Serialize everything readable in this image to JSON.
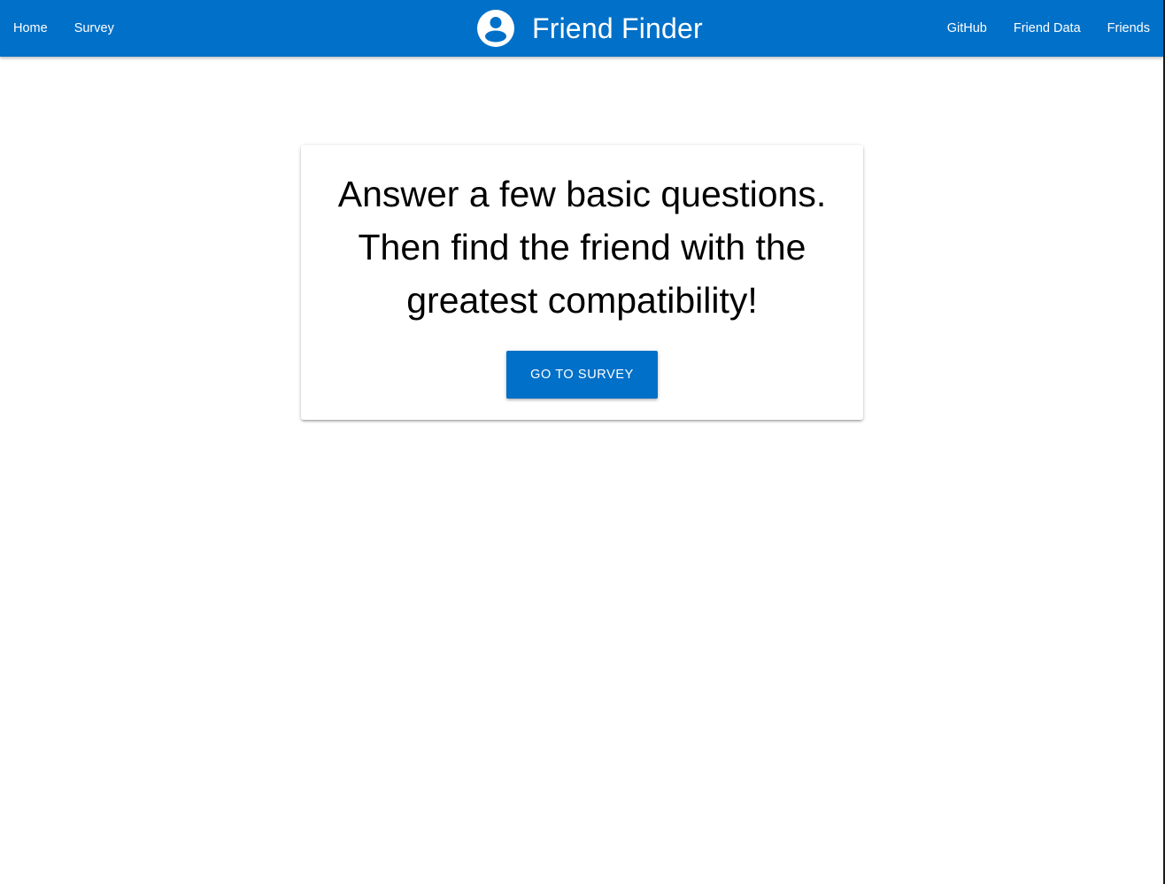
{
  "navbar": {
    "brand_title": "Friend Finder",
    "brand_icon": "account-circle-icon",
    "left_links": [
      {
        "label": "Home"
      },
      {
        "label": "Survey"
      }
    ],
    "right_links": [
      {
        "label": "GitHub"
      },
      {
        "label": "Friend Data"
      },
      {
        "label": "Friends"
      }
    ]
  },
  "hero": {
    "lines": [
      "Answer a few basic questions.",
      "Then find the friend with the",
      "greatest compatibility!"
    ],
    "cta_label": "GO TO SURVEY"
  },
  "colors": {
    "primary": "#0170c8",
    "text": "#000000",
    "background": "#ffffff"
  }
}
